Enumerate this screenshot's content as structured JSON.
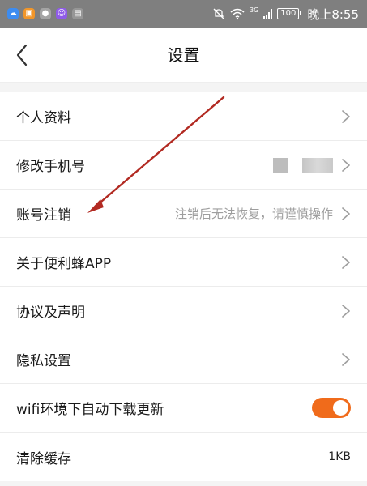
{
  "status_bar": {
    "battery": "100",
    "network": "3G",
    "time": "晚上8:55"
  },
  "header": {
    "title": "设置"
  },
  "settings": {
    "items": [
      {
        "label": "个人资料"
      },
      {
        "label": "修改手机号"
      },
      {
        "label": "账号注销",
        "hint": "注销后无法恢复，请谨慎操作"
      },
      {
        "label": "关于便利蜂APP"
      },
      {
        "label": "协议及声明"
      },
      {
        "label": "隐私设置"
      },
      {
        "label": "wifi环境下自动下载更新",
        "toggle": true
      },
      {
        "label": "清除缓存",
        "value": "1KB"
      }
    ]
  },
  "colors": {
    "accent": "#f06b1b",
    "annotation": "#b22a22"
  },
  "icons": {
    "back": "chevron-left-icon",
    "row": "chevron-right-icon",
    "wifi": "wifi-icon",
    "mute": "mute-icon"
  }
}
